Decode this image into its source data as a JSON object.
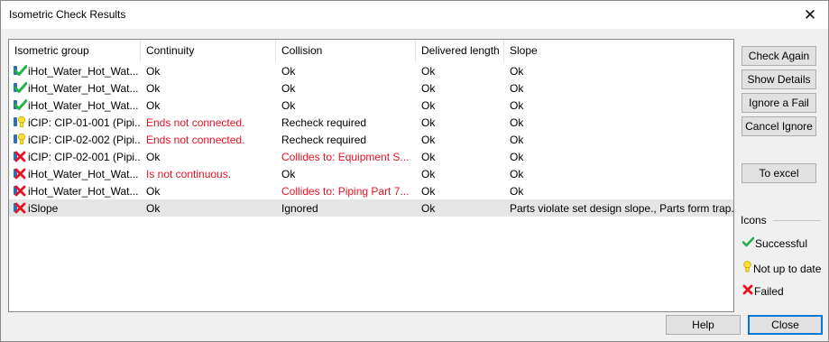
{
  "window": {
    "title": "Isometric Check Results",
    "close_glyph": "✕"
  },
  "table": {
    "columns": [
      "Isometric group",
      "Continuity",
      "Collision",
      "Delivered length",
      "Slope"
    ],
    "rows": [
      {
        "icon": "check-icon",
        "group": "iHot_Water_Hot_Wat...",
        "continuity": "Ok",
        "continuity_error": false,
        "collision": "Ok",
        "collision_error": false,
        "length": "Ok",
        "slope": "Ok",
        "selected": false
      },
      {
        "icon": "check-icon",
        "group": "iHot_Water_Hot_Wat...",
        "continuity": "Ok",
        "continuity_error": false,
        "collision": "Ok",
        "collision_error": false,
        "length": "Ok",
        "slope": "Ok",
        "selected": false
      },
      {
        "icon": "check-icon",
        "group": "iHot_Water_Hot_Wat...",
        "continuity": "Ok",
        "continuity_error": false,
        "collision": "Ok",
        "collision_error": false,
        "length": "Ok",
        "slope": "Ok",
        "selected": false
      },
      {
        "icon": "not-up-to-date-icon",
        "group": "iCIP: CIP-01-001 (Pipi...",
        "continuity": "Ends not connected.",
        "continuity_error": true,
        "collision": "Recheck required",
        "collision_error": false,
        "length": "Ok",
        "slope": "Ok",
        "selected": false
      },
      {
        "icon": "not-up-to-date-icon",
        "group": "iCIP: CIP-02-002 (Pipi...",
        "continuity": "Ends not connected.",
        "continuity_error": true,
        "collision": "Recheck required",
        "collision_error": false,
        "length": "Ok",
        "slope": "Ok",
        "selected": false
      },
      {
        "icon": "failed-icon",
        "group": "iCIP: CIP-02-001 (Pipi...",
        "continuity": "Ok",
        "continuity_error": false,
        "collision": "Collides to: Equipment S...",
        "collision_error": true,
        "length": "Ok",
        "slope": "Ok",
        "selected": false
      },
      {
        "icon": "failed-icon",
        "group": "iHot_Water_Hot_Wat...",
        "continuity": "Is not continuous.",
        "continuity_error": true,
        "collision": "Ok",
        "collision_error": false,
        "length": "Ok",
        "slope": "Ok",
        "selected": false
      },
      {
        "icon": "failed-icon",
        "group": "iHot_Water_Hot_Wat...",
        "continuity": "Ok",
        "continuity_error": false,
        "collision": "Collides to: Piping Part 7...",
        "collision_error": true,
        "length": "Ok",
        "slope": "Ok",
        "selected": false
      },
      {
        "icon": "failed-icon",
        "group": "iSlope",
        "continuity": "Ok",
        "continuity_error": false,
        "collision": "Ignored",
        "collision_error": false,
        "length": "Ok",
        "slope": "Parts violate set design slope., Parts form trap.",
        "selected": true
      }
    ]
  },
  "buttons": {
    "check_again": "Check Again",
    "show_details": "Show Details",
    "ignore_fail": "Ignore a Fail",
    "cancel_ignore": "Cancel Ignore",
    "to_excel": "To excel",
    "help": "Help",
    "close": "Close"
  },
  "legend": {
    "title": "Icons",
    "items": [
      {
        "icon": "check-icon",
        "label": "Successful"
      },
      {
        "icon": "not-up-to-date-icon",
        "label": "Not up to date"
      },
      {
        "icon": "failed-icon",
        "label": "Failed"
      }
    ]
  },
  "colors": {
    "error_text": "#e81123",
    "success": "#22b14c",
    "warning": "#ffe135",
    "fail": "#e81123",
    "selected_row": "#e5e5e5",
    "default_button_border": "#0078d7"
  }
}
